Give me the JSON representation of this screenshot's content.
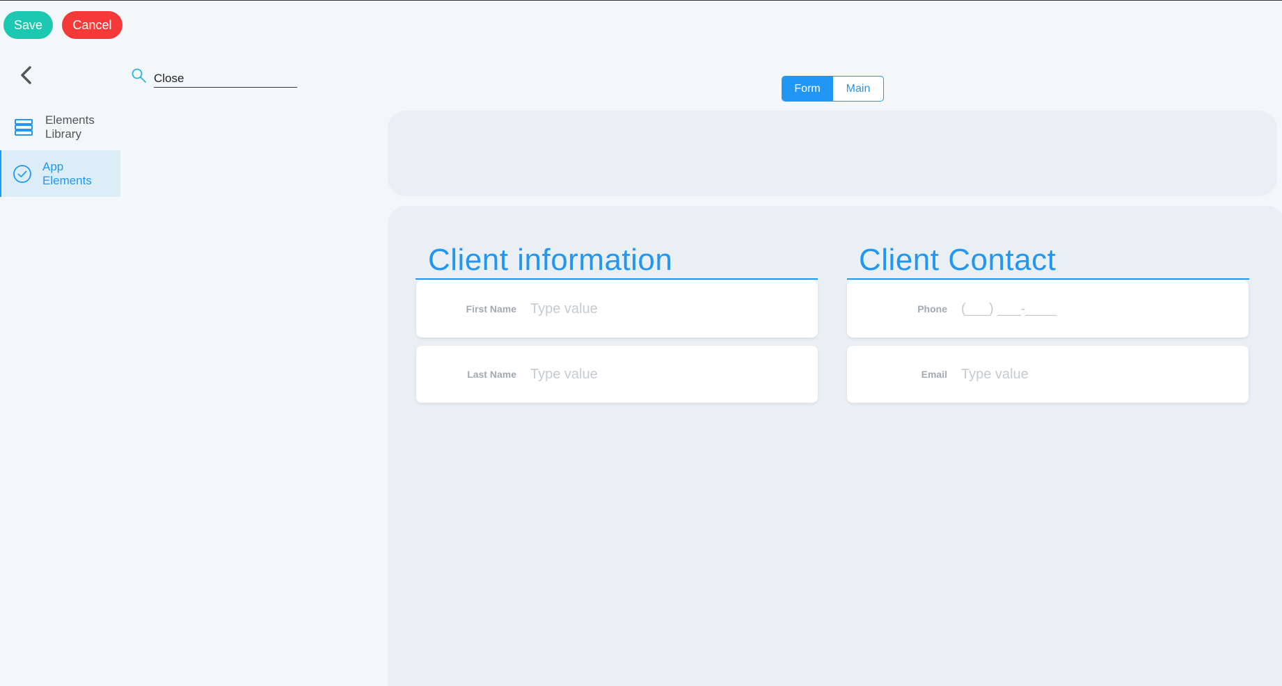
{
  "toolbar": {
    "save_label": "Save",
    "cancel_label": "Cancel"
  },
  "sidebar": {
    "items": [
      {
        "label": "Elements Library",
        "icon": "stack-icon"
      },
      {
        "label": "App Elements",
        "icon": "check-circle-icon"
      }
    ]
  },
  "search": {
    "value": "Close",
    "placeholder": ""
  },
  "view_toggle": {
    "tabs": [
      {
        "label": "Form"
      },
      {
        "label": "Main"
      }
    ],
    "active": "Form"
  },
  "form": {
    "sections": [
      {
        "title": "Client information",
        "fields": [
          {
            "label": "First Name",
            "placeholder": "Type value"
          },
          {
            "label": "Last Name",
            "placeholder": "Type value"
          }
        ]
      },
      {
        "title": "Client Contact",
        "fields": [
          {
            "label": "Phone",
            "placeholder": "(___) ___-____"
          },
          {
            "label": "Email",
            "placeholder": "Type value"
          }
        ]
      }
    ]
  },
  "colors": {
    "accent": "#2196f3",
    "save": "#1cc8b0",
    "cancel": "#f53838",
    "panel": "#e9eff3"
  }
}
